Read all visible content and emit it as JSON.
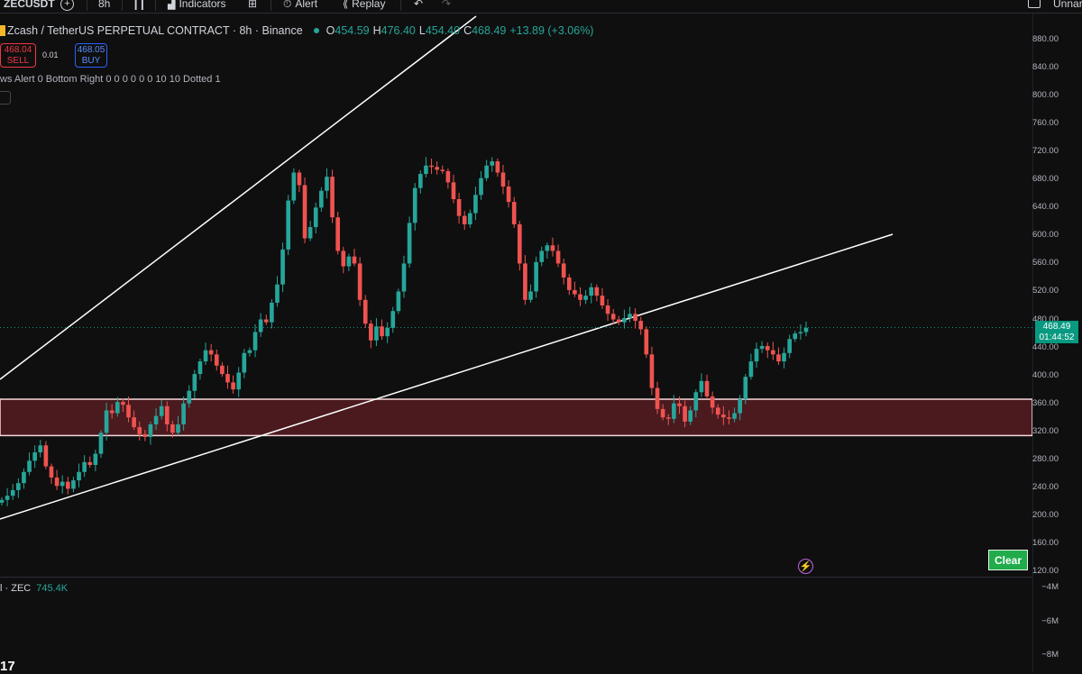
{
  "toolbar": {
    "symbol": "ZECUSDT",
    "interval": "8h",
    "indicators_label": "Indicators",
    "alert_label": "Alert",
    "replay_label": "Replay",
    "layout_name": "Unnar"
  },
  "legend": {
    "title": "Zcash / TetherUS PERPETUAL CONTRACT · 8h · Binance",
    "o_key": "O",
    "o_val": "454.59",
    "h_key": "H",
    "h_val": "476.40",
    "l_key": "L",
    "l_val": "454.40",
    "c_key": "C",
    "c_val": "468.49",
    "change": "+13.89 (+3.06%)"
  },
  "trade": {
    "sell_price": "468.04",
    "sell_label": "SELL",
    "spread": "0.01",
    "buy_price": "468.05",
    "buy_label": "BUY"
  },
  "indicator_text": "ws Alert 0 Bottom Right 0 0 0 0 0 0 10 10 Dotted 1",
  "price_axis": [
    "880.00",
    "840.00",
    "800.00",
    "760.00",
    "720.00",
    "680.00",
    "640.00",
    "600.00",
    "560.00",
    "520.00",
    "480.00",
    "440.00",
    "400.00",
    "360.00",
    "320.00",
    "280.00",
    "240.00",
    "200.00",
    "160.00",
    "120.00"
  ],
  "volume_axis": [
    "−4M",
    "−6M",
    "−8M"
  ],
  "last_price_tag": {
    "price": "468.49",
    "countdown": "01:44:52"
  },
  "clear_button": "Clear",
  "volume": {
    "label": "l · ZEC",
    "value": "745.4K"
  },
  "logo_text": "17",
  "colors": {
    "up": "#26a69a",
    "down": "#ef5350",
    "zone_fill": "#4a1a1f",
    "zone_border": "#f7d6d9",
    "tag": "#089981",
    "clear": "#22ab4b"
  },
  "chart_data": {
    "type": "candlestick",
    "symbol": "ZECUSDT",
    "interval": "8h",
    "ylim": [
      120,
      880
    ],
    "closes": [
      222,
      228,
      236,
      246,
      262,
      278,
      290,
      300,
      270,
      254,
      242,
      248,
      238,
      250,
      262,
      276,
      272,
      288,
      318,
      350,
      346,
      362,
      358,
      340,
      326,
      316,
      312,
      330,
      342,
      356,
      330,
      318,
      330,
      360,
      378,
      402,
      420,
      436,
      430,
      414,
      402,
      390,
      380,
      404,
      432,
      436,
      462,
      480,
      476,
      504,
      530,
      580,
      650,
      690,
      672,
      596,
      612,
      640,
      664,
      684,
      626,
      578,
      556,
      570,
      560,
      508,
      474,
      450,
      470,
      456,
      468,
      492,
      520,
      560,
      618,
      668,
      688,
      700,
      698,
      694,
      692,
      676,
      652,
      628,
      616,
      632,
      658,
      682,
      700,
      706,
      690,
      670,
      648,
      616,
      560,
      508,
      520,
      562,
      578,
      586,
      578,
      560,
      540,
      522,
      516,
      508,
      514,
      526,
      514,
      500,
      488,
      480,
      476,
      482,
      488,
      478,
      466,
      430,
      382,
      352,
      340,
      338,
      360,
      356,
      334,
      350,
      376,
      392,
      370,
      354,
      344,
      340,
      338,
      346,
      366,
      398,
      420,
      438,
      442,
      436,
      430,
      420,
      432,
      452,
      460,
      462,
      468
    ],
    "support_zone": {
      "top": 366,
      "bottom": 314
    },
    "last_close": 468.49,
    "volume_axis_ticks": [
      "−4M",
      "−6M",
      "−8M"
    ]
  }
}
